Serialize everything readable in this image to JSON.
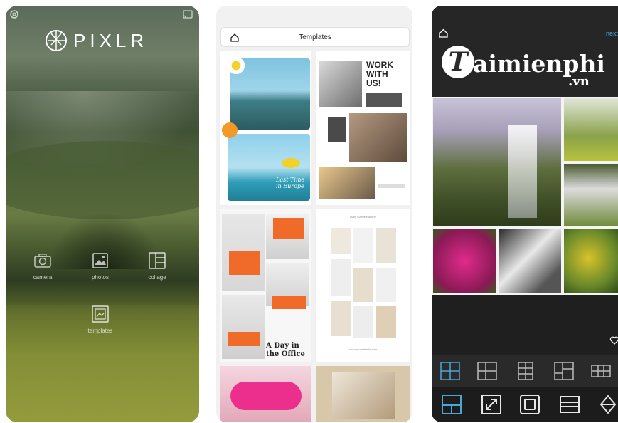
{
  "pixlr": {
    "logo_text": "PIXLR",
    "buttons": [
      {
        "label": "camera",
        "icon": "camera-icon"
      },
      {
        "label": "photos",
        "icon": "photos-icon"
      },
      {
        "label": "collage",
        "icon": "collage-icon"
      },
      {
        "label": "templates",
        "icon": "templates-icon"
      }
    ],
    "icons": {
      "settings": "gear-icon",
      "cast": "cast-icon"
    }
  },
  "templates": {
    "title": "Templates",
    "cards": [
      {
        "script_text": "Last Time in Europe"
      },
      {
        "headline": [
          "WORK",
          "WITH",
          "US!"
        ]
      },
      {
        "headline": [
          "A Day in",
          "the Office"
        ]
      },
      {
        "caption_top": "Daily Coffee Routine",
        "caption_bottom": "www.yourwebsite.com"
      }
    ]
  },
  "collage": {
    "next_label": "next",
    "watermark_main": "aimienphi",
    "watermark_letter": "T",
    "watermark_suffix": ".vn",
    "accent_color": "#4aa8d8",
    "layout_icons": [
      "layout-2x2-icon",
      "layout-grid-icon",
      "layout-columns-icon",
      "layout-mixed-icon",
      "layout-rows-icon"
    ],
    "tool_icons": [
      "layout-tool-icon",
      "resize-icon",
      "border-icon",
      "spacing-icon",
      "fill-icon"
    ]
  }
}
